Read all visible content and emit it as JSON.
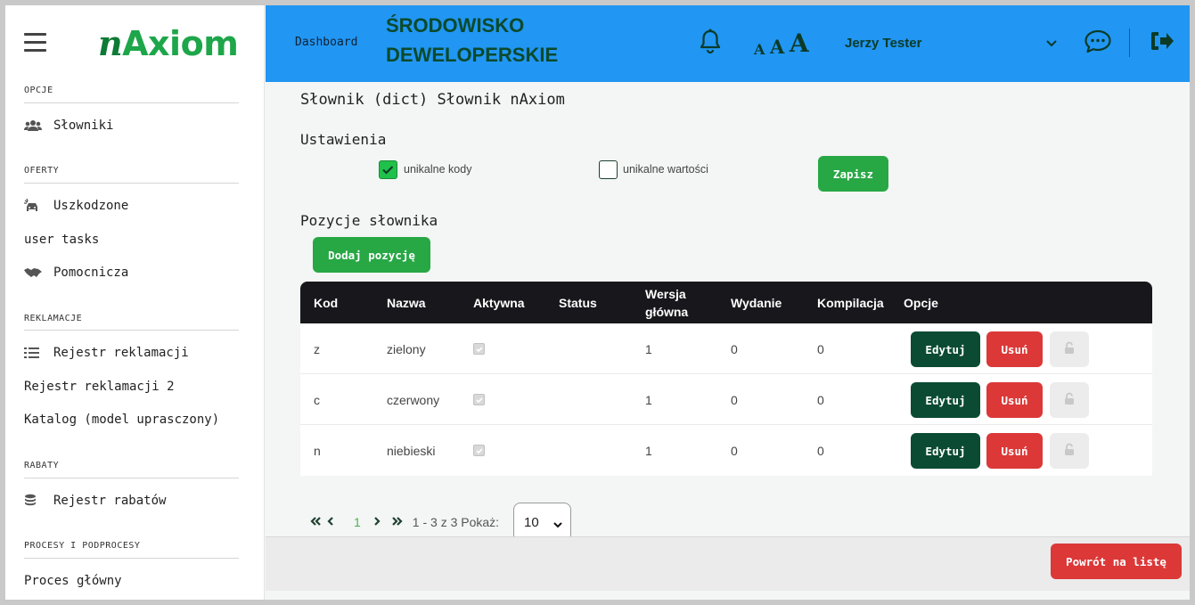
{
  "sidebar": {
    "logo": {
      "n": "n",
      "rest": "Axiom"
    },
    "sections": [
      {
        "label": "OPCJE",
        "items": [
          {
            "label": "Słowniki",
            "icon": "users-icon"
          }
        ]
      },
      {
        "label": "OFERTY",
        "items": [
          {
            "label": "Uszkodzone",
            "icon": "car-crash-icon"
          },
          {
            "label": "user tasks",
            "icon": ""
          },
          {
            "label": "Pomocnicza",
            "icon": "handshake-icon"
          }
        ]
      },
      {
        "label": "REKLAMACJE",
        "items": [
          {
            "label": "Rejestr reklamacji",
            "icon": "list-icon"
          },
          {
            "label": "Rejestr reklamacji 2",
            "icon": ""
          },
          {
            "label": "Katalog (model uprasczony)",
            "icon": ""
          }
        ]
      },
      {
        "label": "RABATY",
        "items": [
          {
            "label": "Rejestr rabatów",
            "icon": "coins-icon"
          }
        ]
      },
      {
        "label": "PROCESY I PODPROCESY",
        "items": [
          {
            "label": "Proces główny",
            "icon": ""
          }
        ]
      }
    ]
  },
  "header": {
    "dashboard": "Dashboard",
    "env_line1": "ŚRODOWISKO",
    "env_line2": "DEWELOPERSKIE",
    "font_sizes": [
      "A",
      "A",
      "A"
    ],
    "user": "Jerzy Tester",
    "colors": {
      "bar": "#2196f3",
      "text": "#0b3b27"
    }
  },
  "main": {
    "title": "Słownik (dict) Słownik nAxiom",
    "settings_heading": "Ustawienia",
    "unique_codes": {
      "label": "unikalne kody",
      "checked": true
    },
    "unique_values": {
      "label": "unikalne wartości",
      "checked": false
    },
    "save_label": "Zapisz",
    "positions_heading": "Pozycje słownika",
    "add_label": "Dodaj pozycję",
    "table": {
      "headers": [
        "Kod",
        "Nazwa",
        "Aktywna",
        "Status",
        "Wersja główna",
        "Wydanie",
        "Kompilacja",
        "Opcje"
      ],
      "rows": [
        {
          "kod": "z",
          "nazwa": "zielony",
          "aktywna": true,
          "status": "",
          "wersja": "1",
          "wydanie": "0",
          "kompilacja": "0"
        },
        {
          "kod": "c",
          "nazwa": "czerwony",
          "aktywna": true,
          "status": "",
          "wersja": "1",
          "wydanie": "0",
          "kompilacja": "0"
        },
        {
          "kod": "n",
          "nazwa": "niebieski",
          "aktywna": true,
          "status": "",
          "wersja": "1",
          "wydanie": "0",
          "kompilacja": "0"
        }
      ],
      "edit_label": "Edytuj",
      "delete_label": "Usuń"
    },
    "pager": {
      "current": "1",
      "summary": "1 - 3 z 3 Pokaż:",
      "page_size": "10"
    },
    "back_label": "Powrót na listę"
  },
  "colors": {
    "green": "#28a745",
    "dark_green": "#0b4b33",
    "red": "#dc3838",
    "table_head": "#17171c"
  }
}
